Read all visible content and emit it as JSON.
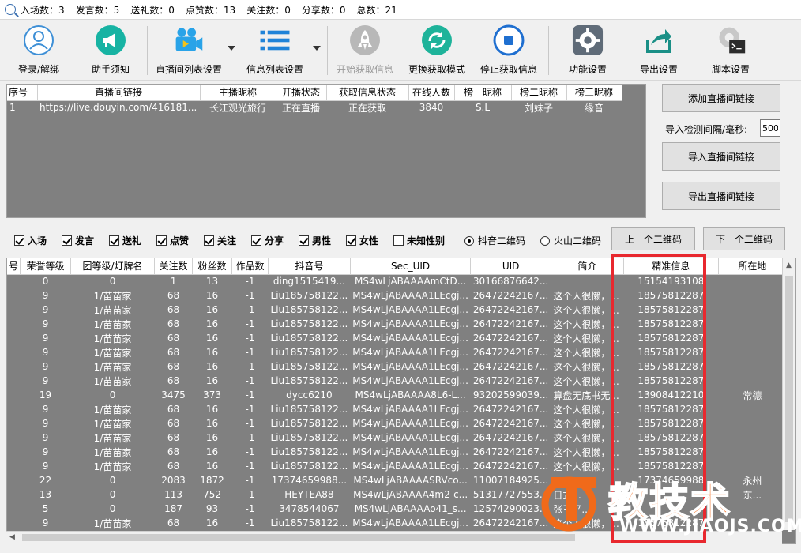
{
  "stats": [
    "入场数：3",
    "发言数：5",
    "送礼数：0",
    "点赞数：13",
    "关注数：0",
    "分享数：0",
    "总数：21"
  ],
  "toolbar": {
    "login": "登录/解绑",
    "helper": "助手须知",
    "live_list": "直播间列表设置",
    "info_list": "信息列表设置",
    "start": "开始获取信息",
    "switch_mode": "更换获取模式",
    "stop": "停止获取信息",
    "features": "功能设置",
    "export": "导出设置",
    "script": "脚本设置"
  },
  "live_table": {
    "headers": [
      "序号",
      "直播间链接",
      "主播昵称",
      "开播状态",
      "获取信息状态",
      "在线人数",
      "榜一昵称",
      "榜二昵称",
      "榜三昵称"
    ],
    "rows": [
      [
        "1",
        "https://live.douyin.com/416181...",
        "长江观光旅行",
        "正在直播",
        "正在获取",
        "3840",
        "S.L",
        "刘妹子",
        "缘音"
      ]
    ]
  },
  "side": {
    "add_link": "添加直播间链接",
    "interval_label": "导入检测间隔/毫秒:",
    "interval_value": "500",
    "import_link": "导入直播间链接",
    "export_link": "导出直播间链接"
  },
  "filters": {
    "checks": [
      {
        "label": "入场",
        "checked": true
      },
      {
        "label": "发言",
        "checked": true
      },
      {
        "label": "送礼",
        "checked": true
      },
      {
        "label": "点赞",
        "checked": true
      },
      {
        "label": "关注",
        "checked": true
      },
      {
        "label": "分享",
        "checked": true
      },
      {
        "label": "男性",
        "checked": true
      },
      {
        "label": "女性",
        "checked": true
      },
      {
        "label": "未知性别",
        "checked": false
      }
    ],
    "radio_douyin": "抖音二维码",
    "radio_huoshan": "火山二维码",
    "prev_qr": "上一个二维码",
    "next_qr": "下一个二维码"
  },
  "info_table": {
    "headers": [
      "号",
      "荣誉等级",
      "团等级/灯牌名",
      "关注数",
      "粉丝数",
      "作品数",
      "抖音号",
      "Sec_UID",
      "UID",
      "简介",
      "精准信息",
      "所在地"
    ],
    "rows": [
      [
        "",
        "0",
        "0",
        "1",
        "13",
        "-1",
        "ding1515419...",
        "MS4wLjABAAAAmCtD...",
        "30166876642...",
        "",
        "15154193108",
        ""
      ],
      [
        "",
        "9",
        "1/苗苗家",
        "68",
        "16",
        "-1",
        "Liu185758122...",
        "MS4wLjABAAAA1LEcgj...",
        "26472242167...",
        "这个人很懒，...",
        "18575812287",
        ""
      ],
      [
        "",
        "9",
        "1/苗苗家",
        "68",
        "16",
        "-1",
        "Liu185758122...",
        "MS4wLjABAAAA1LEcgj...",
        "26472242167...",
        "这个人很懒，...",
        "18575812287",
        ""
      ],
      [
        "",
        "9",
        "1/苗苗家",
        "68",
        "16",
        "-1",
        "Liu185758122...",
        "MS4wLjABAAAA1LEcgj...",
        "26472242167...",
        "这个人很懒，...",
        "18575812287",
        ""
      ],
      [
        "",
        "9",
        "1/苗苗家",
        "68",
        "16",
        "-1",
        "Liu185758122...",
        "MS4wLjABAAAA1LEcgj...",
        "26472242167...",
        "这个人很懒，...",
        "18575812287",
        ""
      ],
      [
        "",
        "9",
        "1/苗苗家",
        "68",
        "16",
        "-1",
        "Liu185758122...",
        "MS4wLjABAAAA1LEcgj...",
        "26472242167...",
        "这个人很懒，...",
        "18575812287",
        ""
      ],
      [
        "",
        "9",
        "1/苗苗家",
        "68",
        "16",
        "-1",
        "Liu185758122...",
        "MS4wLjABAAAA1LEcgj...",
        "26472242167...",
        "这个人很懒，...",
        "18575812287",
        ""
      ],
      [
        "",
        "9",
        "1/苗苗家",
        "68",
        "16",
        "-1",
        "Liu185758122...",
        "MS4wLjABAAAA1LEcgj...",
        "26472242167...",
        "这个人很懒，...",
        "18575812287",
        ""
      ],
      [
        "",
        "19",
        "0",
        "3475",
        "373",
        "-1",
        "dycc6210",
        "MS4wLjABAAAA8L6-L...",
        "93202599039...",
        "算盘无底书无...",
        "13908412210",
        "常德"
      ],
      [
        "",
        "9",
        "1/苗苗家",
        "68",
        "16",
        "-1",
        "Liu185758122...",
        "MS4wLjABAAAA1LEcgj...",
        "26472242167...",
        "这个人很懒，...",
        "18575812287",
        ""
      ],
      [
        "",
        "9",
        "1/苗苗家",
        "68",
        "16",
        "-1",
        "Liu185758122...",
        "MS4wLjABAAAA1LEcgj...",
        "26472242167...",
        "这个人很懒，...",
        "18575812287",
        ""
      ],
      [
        "",
        "9",
        "1/苗苗家",
        "68",
        "16",
        "-1",
        "Liu185758122...",
        "MS4wLjABAAAA1LEcgj...",
        "26472242167...",
        "这个人很懒，...",
        "18575812287",
        ""
      ],
      [
        "",
        "9",
        "1/苗苗家",
        "68",
        "16",
        "-1",
        "Liu185758122...",
        "MS4wLjABAAAA1LEcgj...",
        "26472242167...",
        "这个人很懒，...",
        "18575812287",
        ""
      ],
      [
        "",
        "9",
        "1/苗苗家",
        "68",
        "16",
        "-1",
        "Liu185758122...",
        "MS4wLjABAAAA1LEcgj...",
        "26472242167...",
        "这个人很懒，...",
        "18575812287",
        ""
      ],
      [
        "",
        "22",
        "0",
        "2083",
        "1872",
        "-1",
        "17374659988...",
        "MS4wLjABAAAASRVco...",
        "11007184925...",
        "",
        "17374659988",
        "永州"
      ],
      [
        "",
        "13",
        "0",
        "113",
        "752",
        "-1",
        "HEYTEA88",
        "MS4wLjABAAAA4m2-c...",
        "51317727553...",
        "日式...",
        "",
        "东..."
      ],
      [
        "",
        "5",
        "0",
        "187",
        "93",
        "-1",
        "3478544067",
        "MS4wLjABAAAAo41_s...",
        "12574290023...",
        "张玉平...",
        "",
        ""
      ],
      [
        "",
        "9",
        "1/苗苗家",
        "68",
        "16",
        "-1",
        "Liu185758122...",
        "MS4wLjABAAAA1LEcgj...",
        "26472242167...",
        "这个人很懒，...",
        "18575812287",
        ""
      ]
    ]
  },
  "watermark": {
    "brand": "教技术",
    "url": "WWW.JIAOJS.COM"
  },
  "colors": {
    "grid_bg": "#808080",
    "highlight": "#e8282e",
    "watermark_orange": "#f06a1a"
  }
}
